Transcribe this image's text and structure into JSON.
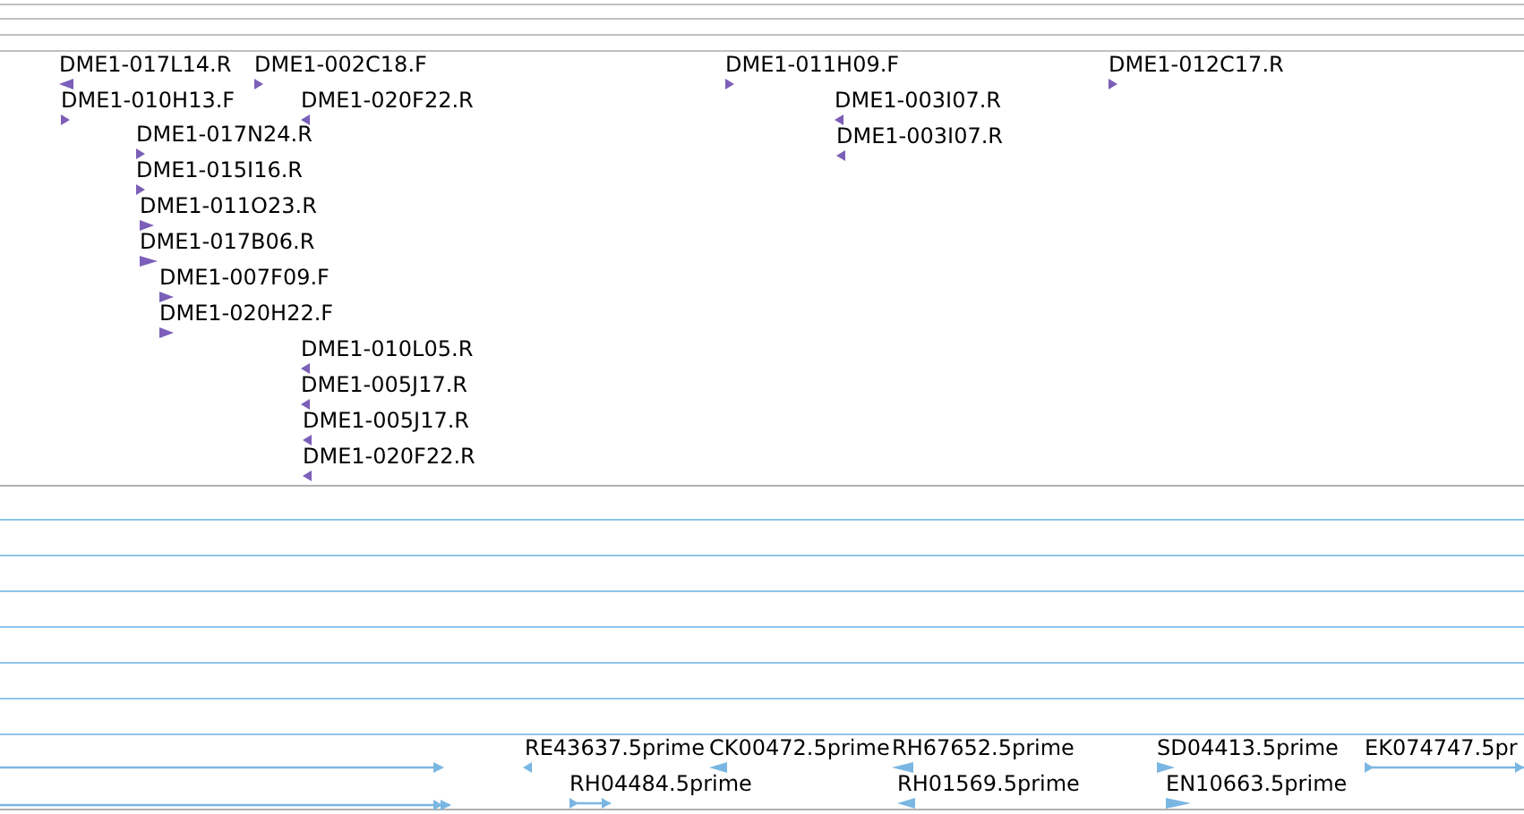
{
  "tracks": [
    {
      "kind": "clone-ends",
      "color": "#7b5fb8",
      "features": [
        {
          "label": "DME1-017L14.R",
          "reverse": true
        },
        {
          "label": "DME1-002C18.F",
          "reverse": false
        },
        {
          "label": "DME1-010H13.F",
          "reverse": false
        },
        {
          "label": "DME1-020F22.R",
          "reverse": true
        },
        {
          "label": "DME1-017N24.R",
          "reverse": false
        },
        {
          "label": "DME1-015I16.R",
          "reverse": false
        },
        {
          "label": "DME1-011O23.R",
          "reverse": false
        },
        {
          "label": "DME1-017B06.R",
          "reverse": false
        },
        {
          "label": "DME1-007F09.F",
          "reverse": false
        },
        {
          "label": "DME1-020H22.F",
          "reverse": false
        },
        {
          "label": "DME1-010L05.R",
          "reverse": true
        },
        {
          "label": "DME1-005J17.R",
          "reverse": true
        },
        {
          "label": "DME1-005J17.R",
          "reverse": true
        },
        {
          "label": "DME1-020F22.R",
          "reverse": true
        },
        {
          "label": "DME1-011H09.F",
          "reverse": false
        },
        {
          "label": "DME1-003I07.R",
          "reverse": true
        },
        {
          "label": "DME1-003I07.R",
          "reverse": true
        },
        {
          "label": "DME1-012C17.R",
          "reverse": false
        }
      ]
    },
    {
      "kind": "ests",
      "color": "#7ab6e2",
      "features": [
        {
          "label": "RE43637.5prime",
          "reverse": true
        },
        {
          "label": "CK00472.5prime",
          "reverse": true
        },
        {
          "label": "RH67652.5prime",
          "reverse": true
        },
        {
          "label": "SD04413.5prime",
          "reverse": false
        },
        {
          "label": "EK074747.5pr",
          "reverse": false
        },
        {
          "label": "RH04484.5prime",
          "reverse": false
        },
        {
          "label": "RH01569.5prime",
          "reverse": true
        },
        {
          "label": "EN10663.5prime",
          "reverse": false
        }
      ]
    }
  ]
}
